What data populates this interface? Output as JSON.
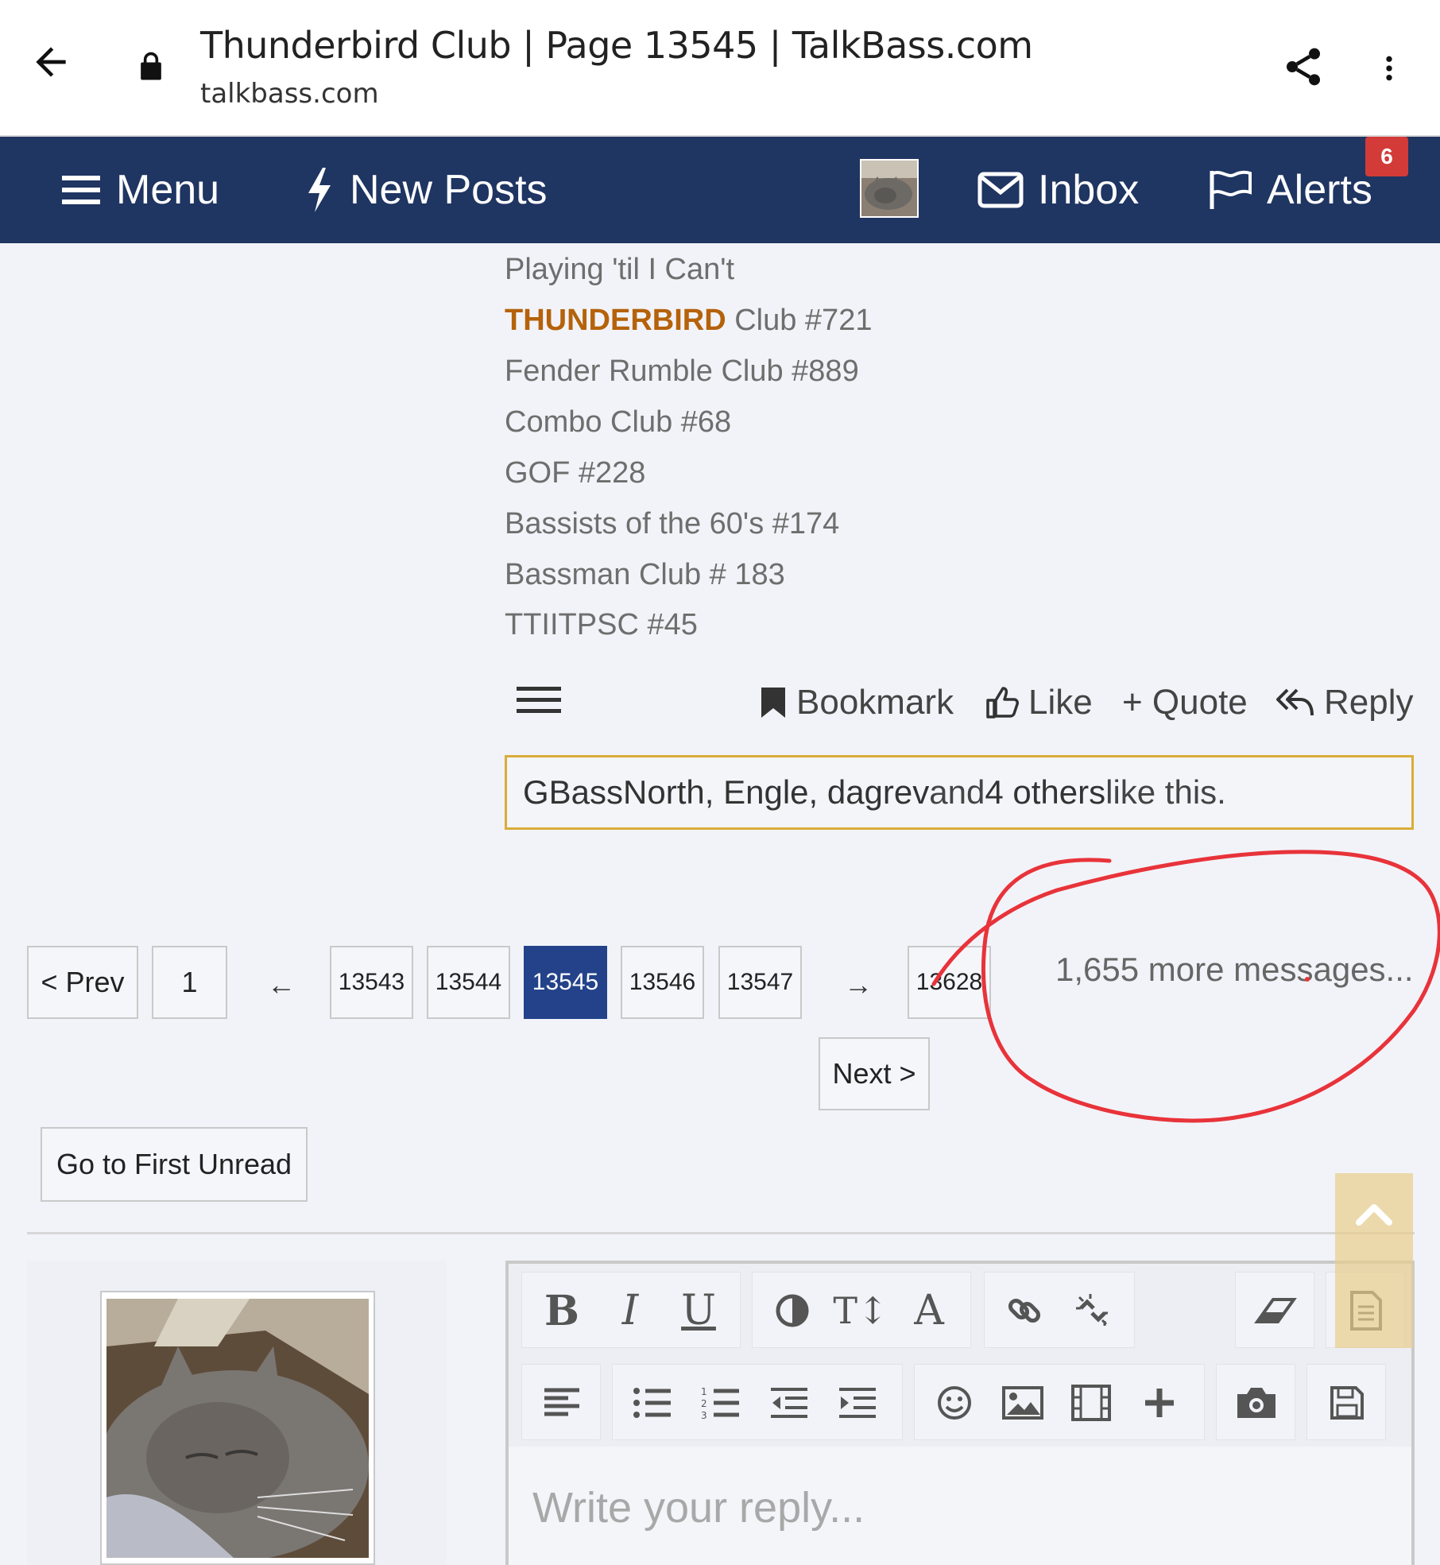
{
  "browser": {
    "title": "Thunderbird Club | Page 13545 | TalkBass.com",
    "domain": "talkbass.com"
  },
  "nav": {
    "menu_label": "Menu",
    "new_posts_label": "New Posts",
    "inbox_label": "Inbox",
    "alerts_label": "Alerts",
    "alerts_count": "6",
    "bar_color": "#1f3562"
  },
  "signature": {
    "line1": "Playing 'til I Can't",
    "line2_strong": "THUNDERBIRD",
    "line2_rest": " Club #721",
    "line3": "Fender Rumble Club #889",
    "line4": "Combo Club #68",
    "line5": "GOF #228",
    "line6": "Bassists of the 60's #174",
    "line7": "Bassman Club # 183",
    "line8": "TTIITPSC #45"
  },
  "post_actions": {
    "bookmark": "Bookmark",
    "like": "Like",
    "quote": "+ Quote",
    "reply": "Reply"
  },
  "likes": {
    "users": "GBassNorth, Engle, dagrev",
    "and": " and ",
    "others": "4 others",
    "suffix": " like this."
  },
  "pagination": {
    "prev": "< Prev",
    "first": "1",
    "left_arrow": "←",
    "pages": [
      "13543",
      "13544",
      "13545",
      "13546",
      "13547"
    ],
    "current": "13545",
    "right_arrow": "→",
    "last": "13628",
    "next": "Next >",
    "more_messages": "1,655 more messages..."
  },
  "go_first_unread": "Go to First Unread",
  "editor": {
    "placeholder": "Write your reply...",
    "toolbar_row1": [
      "bold-icon",
      "italic-icon",
      "underline-icon",
      "color-icon",
      "font-size-icon",
      "font-family-icon",
      "link-icon",
      "unlink-icon",
      "eraser-icon",
      "template-icon"
    ],
    "toolbar_row2": [
      "align-icon",
      "bullet-list-icon",
      "numbered-list-icon",
      "outdent-icon",
      "indent-icon",
      "smiley-icon",
      "image-icon",
      "media-icon",
      "insert-icon",
      "camera-icon",
      "save-draft-icon"
    ]
  },
  "colors": {
    "accent": "#23428a",
    "thunderbird": "#b5620a",
    "like_border": "#d9ad3a",
    "badge": "#d23b38",
    "annotation": "#e8333a"
  }
}
